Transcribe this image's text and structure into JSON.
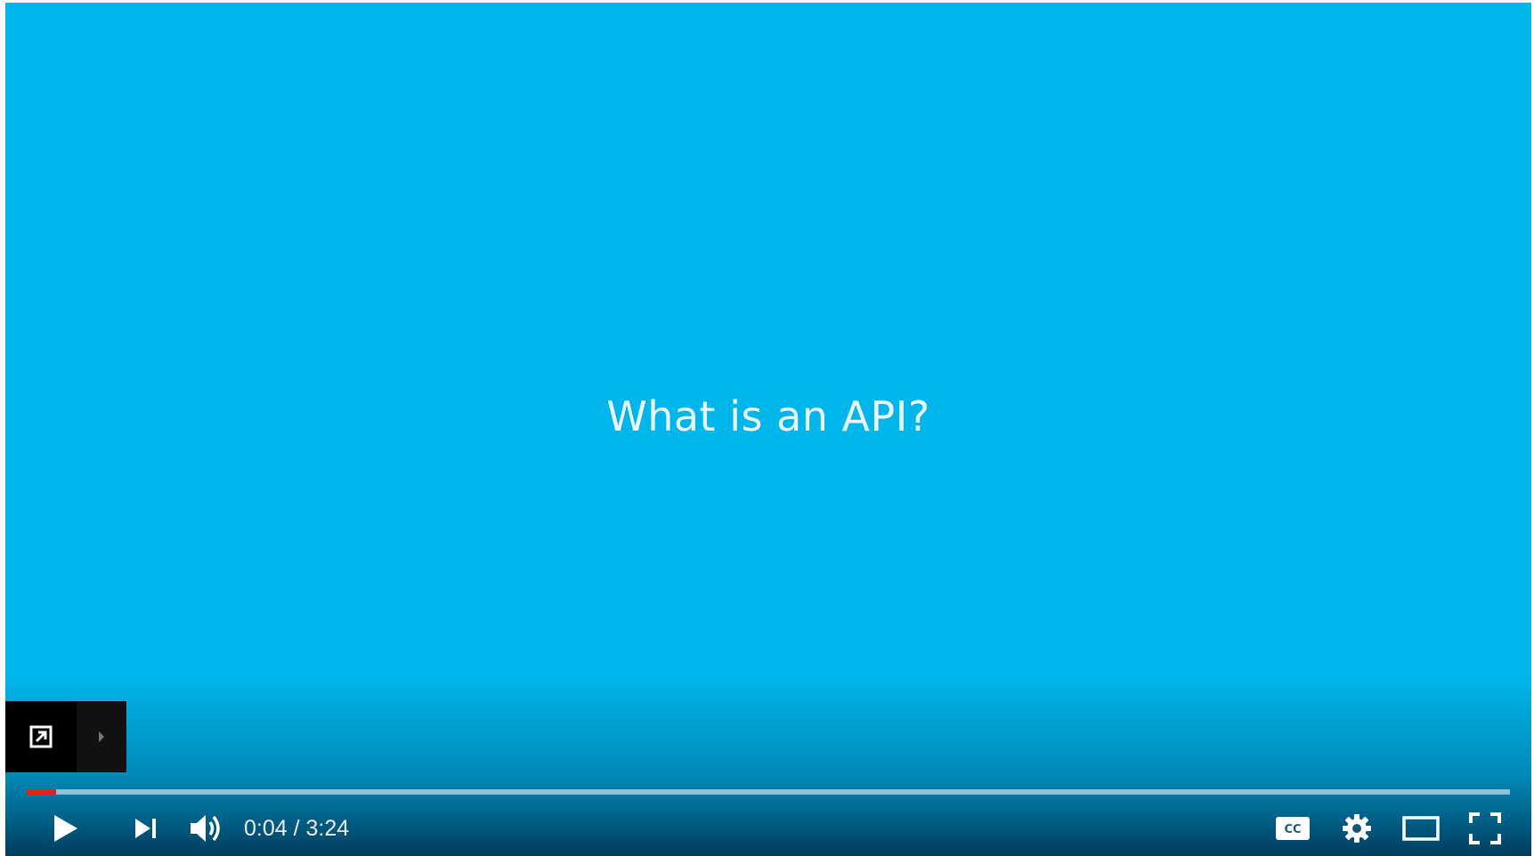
{
  "video": {
    "title": "What is an API?",
    "background_color": "#00b5ea"
  },
  "share": {
    "expand_icon": "external-link-icon",
    "arrow_icon": "chevron-right-icon"
  },
  "progress": {
    "played_fraction": 0.0196,
    "played_color": "#e62117"
  },
  "controls": {
    "play_icon": "play-icon",
    "next_icon": "skip-next-icon",
    "volume_icon": "volume-icon",
    "current_time": "0:04",
    "separator": " / ",
    "duration": "3:24",
    "cc_icon": "closed-captions-icon",
    "settings_icon": "gear-icon",
    "theater_icon": "theater-mode-icon",
    "fullscreen_icon": "fullscreen-icon"
  }
}
